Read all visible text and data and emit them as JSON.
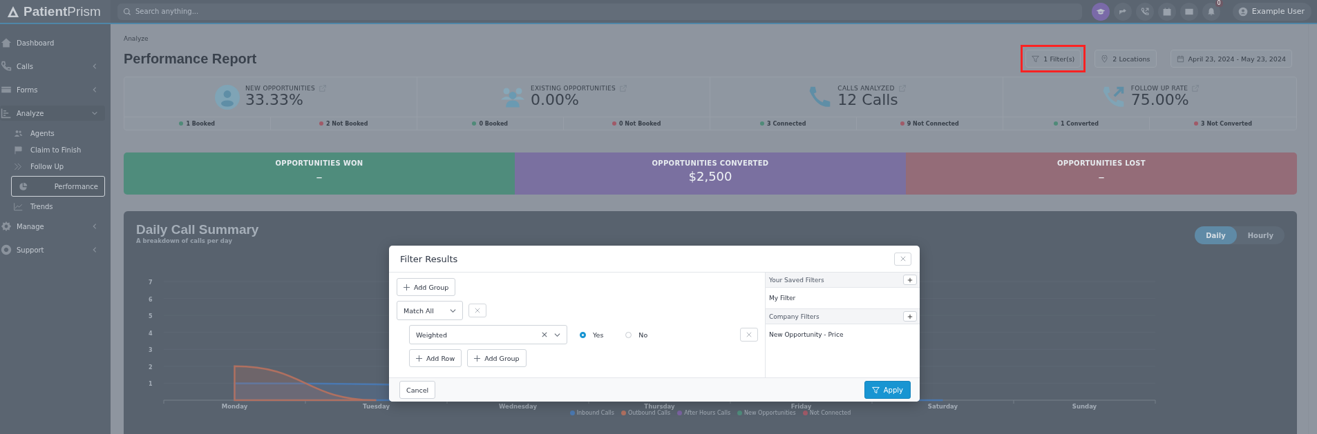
{
  "brand": {
    "bold": "Patient",
    "light": "Prism"
  },
  "search": {
    "placeholder": "Search anything..."
  },
  "header_icons": [
    {
      "kind": "cap",
      "selected": true
    },
    {
      "kind": "share",
      "selected": false
    },
    {
      "kind": "phone-out",
      "selected": false
    },
    {
      "kind": "calendar",
      "selected": false
    },
    {
      "kind": "book",
      "selected": false
    },
    {
      "kind": "bell",
      "selected": false,
      "badge": "0"
    }
  ],
  "user": {
    "name": "Example User"
  },
  "sidebar": {
    "items": [
      {
        "label": "Dashboard",
        "kind": "home"
      },
      {
        "label": "Calls",
        "kind": "phone",
        "expanded": false
      },
      {
        "label": "Forms",
        "kind": "form",
        "expanded": false
      },
      {
        "label": "Analyze",
        "kind": "chart",
        "expanded": true,
        "children": [
          {
            "label": "Agents",
            "kind": "users",
            "selected": false
          },
          {
            "label": "Claim to Finish",
            "kind": "flag",
            "selected": false
          },
          {
            "label": "Follow Up",
            "kind": "chevrons",
            "selected": false
          },
          {
            "label": "Performance",
            "kind": "pie",
            "selected": true
          },
          {
            "label": "Trends",
            "kind": "trend",
            "selected": false
          }
        ]
      },
      {
        "label": "Manage",
        "kind": "gear",
        "expanded": false
      },
      {
        "label": "Support",
        "kind": "lifebuoy",
        "expanded": false
      }
    ]
  },
  "breadcrumb": "Analyze",
  "title": "Performance Report",
  "toolbar": [
    {
      "label": "1 Filter(s)",
      "kind": "filter",
      "highlighted": true
    },
    {
      "label": "2 Locations",
      "kind": "pin",
      "highlighted": false
    },
    {
      "label": "April 23, 2024 - May 23, 2024",
      "kind": "calendar",
      "highlighted": false
    }
  ],
  "stats": [
    {
      "label": "NEW OPPORTUNITIES",
      "value": "33.33%",
      "kind": "person",
      "subs": [
        {
          "text": "1 Booked",
          "color": "#4f8a78"
        },
        {
          "text": "2 Not Booked",
          "color": "#a05a68"
        }
      ]
    },
    {
      "label": "EXISTING OPPORTUNITIES",
      "value": "0.00%",
      "kind": "group",
      "subs": [
        {
          "text": "0 Booked",
          "color": "#4f8a78"
        },
        {
          "text": "0 Not Booked",
          "color": "#a05a68"
        }
      ]
    },
    {
      "label": "CALLS ANALYZED",
      "value": "12 Calls",
      "kind": "phone",
      "subs": [
        {
          "text": "3 Connected",
          "color": "#4f8a78"
        },
        {
          "text": "9 Not Connected",
          "color": "#a05a68"
        }
      ]
    },
    {
      "label": "FOLLOW UP RATE",
      "value": "75.00%",
      "kind": "phone-out",
      "subs": [
        {
          "text": "1 Converted",
          "color": "#4f8a78"
        },
        {
          "text": "3 Not Converted",
          "color": "#a05a68"
        }
      ]
    }
  ],
  "outcomes": [
    {
      "label": "OPPORTUNITIES WON",
      "value": "–",
      "color": "#4f8c7c"
    },
    {
      "label": "OPPORTUNITIES CONVERTED",
      "value": "$2,500",
      "color": "#7a70a0"
    },
    {
      "label": "OPPORTUNITIES LOST",
      "value": "–",
      "color": "#946c78"
    }
  ],
  "chart_panel": {
    "title": "Daily Call Summary",
    "subtitle": "A breakdown of calls per day",
    "toggle": [
      {
        "label": "Daily",
        "selected": true
      },
      {
        "label": "Hourly",
        "selected": false
      }
    ],
    "chart_data": {
      "type": "area",
      "legend": "bottom",
      "categories": [
        "Monday",
        "Tuesday",
        "Wednesday",
        "Thursday",
        "Friday",
        "Saturday",
        "Sunday"
      ],
      "ylim": [
        0,
        7
      ],
      "yticks": [
        1,
        2,
        3,
        4,
        5,
        6,
        7
      ],
      "series": [
        {
          "name": "Inbound Calls",
          "color": "#4a78b0",
          "values": [
            1,
            null,
            null,
            null,
            null,
            0,
            null
          ]
        },
        {
          "name": "Outbound Calls",
          "color": "#b07060",
          "values": [
            2,
            0,
            null,
            null,
            null,
            null,
            null
          ]
        },
        {
          "name": "After Hours Calls",
          "color": "#7a62a0",
          "values": [
            null,
            null,
            null,
            null,
            null,
            null,
            null
          ]
        },
        {
          "name": "New Opportunities",
          "color": "#4f8c7c",
          "values": [
            null,
            null,
            null,
            null,
            null,
            null,
            null
          ]
        },
        {
          "name": "Not Connected",
          "color": "#a05a68",
          "values": [
            null,
            null,
            null,
            null,
            null,
            null,
            null
          ]
        }
      ]
    }
  },
  "filter_dialog": {
    "title": "Filter Results",
    "add_group_top": "Add Group",
    "match": "Match All",
    "rule": {
      "field": "Weighted",
      "options": [
        {
          "label": "Yes",
          "selected": true
        },
        {
          "label": "No",
          "selected": false
        }
      ]
    },
    "add_row": "Add Row",
    "add_group": "Add Group",
    "saved": [
      {
        "title": "Your Saved Filters",
        "items": [
          "My Filter"
        ]
      },
      {
        "title": "Company Filters",
        "items": [
          "New Opportunity - Price"
        ]
      }
    ],
    "cancel": "Cancel",
    "apply": "Apply"
  }
}
